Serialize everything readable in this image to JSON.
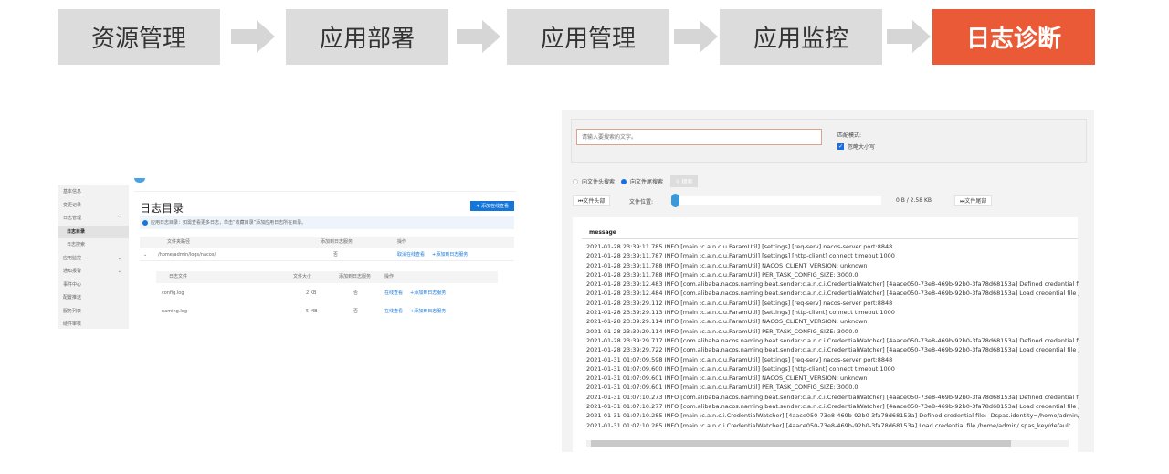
{
  "steps": [
    "资源管理",
    "应用部署",
    "应用管理",
    "应用监控",
    "日志诊断"
  ],
  "left_panel": {
    "sidebar": [
      "基本信息",
      "变更记录",
      "日志管理",
      "日志目录",
      "日志搜索",
      "应用监控",
      "通知报警",
      "事件中心",
      "配置推送",
      "服务列表",
      "硬件审核"
    ],
    "title": "日志目录",
    "add_button": "+ 添加在线查看",
    "info": "应用日志目录：如需查看更多日志，单击“收藏目录”添加应用日志所在目录。",
    "headers": [
      "文件夹路径",
      "添加到日志服务",
      "操作"
    ],
    "folder": {
      "path": "/home/admin/logs/nacos/",
      "added": "否",
      "action1": "取消在线查看",
      "action2": "+添加到日志服务"
    },
    "sub_headers": [
      "日志文件",
      "文件大小",
      "添加到日志服务",
      "操作"
    ],
    "files": [
      {
        "name": "config.log",
        "size": "2 KB",
        "added": "否",
        "action1": "在线查看",
        "action2": "+添加到日志服务"
      },
      {
        "name": "naming.log",
        "size": "5 MB",
        "added": "否",
        "action1": "在线查看",
        "action2": "+添加到日志服务"
      }
    ]
  },
  "right_panel": {
    "search_placeholder": "请输入要搜索的文字。",
    "match_mode_label": "匹配模式:",
    "ignore_case_label": "忽略大小写",
    "ignore_case_checked": true,
    "radio_head": "向文件头搜索",
    "radio_tail": "向文件尾搜索",
    "search_button": "搜索",
    "file_head_button": "文件头部",
    "file_position_label": "文件位置:",
    "position_text": "0 B / 2.58 KB",
    "position_fraction": 0,
    "file_tail_button": "文件尾部",
    "column": "message",
    "lines": [
      "2021-01-28 23:39:11.785 INFO [main :c.a.n.c.u.ParamUtil] [settings] [req-serv] nacos-server port:8848",
      "2021-01-28 23:39:11.787 INFO [main :c.a.n.c.u.ParamUtil] [settings] [http-client] connect timeout:1000",
      "2021-01-28 23:39:11.788 INFO [main :c.a.n.c.u.ParamUtil] NACOS_CLIENT_VERSION: unknown",
      "2021-01-28 23:39:11.788 INFO [main :c.a.n.c.u.ParamUtil] PER_TASK_CONFIG_SIZE: 3000.0",
      "2021-01-28 23:39:12.483 INFO [com.alibaba.nacos.naming.beat.sender:c.a.n.c.i.CredentialWatcher] [4aace050-73e8-469b-92b0-3fa78d68153a] Defined credential file: -Dspas.identity=/home",
      "2021-01-28 23:39:12.484 INFO [com.alibaba.nacos.naming.beat.sender:c.a.n.c.i.CredentialWatcher] [4aace050-73e8-469b-92b0-3fa78d68153a] Load credential file /home/admin/.spas_key/",
      "2021-01-28 23:39:29.112 INFO [main :c.a.n.c.u.ParamUtil] [settings] [req-serv] nacos-server port:8848",
      "2021-01-28 23:39:29.113 INFO [main :c.a.n.c.u.ParamUtil] [settings] [http-client] connect timeout:1000",
      "2021-01-28 23:39:29.114 INFO [main :c.a.n.c.u.ParamUtil] NACOS_CLIENT_VERSION: unknown",
      "2021-01-28 23:39:29.114 INFO [main :c.a.n.c.u.ParamUtil] PER_TASK_CONFIG_SIZE: 3000.0",
      "2021-01-28 23:39:29.717 INFO [com.alibaba.nacos.naming.beat.sender:c.a.n.c.i.CredentialWatcher] [4aace050-73e8-469b-92b0-3fa78d68153a] Defined credential file: -Dspas.identity=/home",
      "2021-01-28 23:39:29.722 INFO [com.alibaba.nacos.naming.beat.sender:c.a.n.c.i.CredentialWatcher] [4aace050-73e8-469b-92b0-3fa78d68153a] Load credential file /home/admin/.spas_key/",
      "2021-01-31 01:07:09.598 INFO [main :c.a.n.c.u.ParamUtil] [settings] [req-serv] nacos-server port:8848",
      "2021-01-31 01:07:09.600 INFO [main :c.a.n.c.u.ParamUtil] [settings] [http-client] connect timeout:1000",
      "2021-01-31 01:07:09.601 INFO [main :c.a.n.c.u.ParamUtil] NACOS_CLIENT_VERSION: unknown",
      "2021-01-31 01:07:09.601 INFO [main :c.a.n.c.u.ParamUtil] PER_TASK_CONFIG_SIZE: 3000.0",
      "2021-01-31 01:07:10.273 INFO [com.alibaba.nacos.naming.beat.sender:c.a.n.c.i.CredentialWatcher] [4aace050-73e8-469b-92b0-3fa78d68153a] Defined credential file: -Dspas.identity=/home",
      "2021-01-31 01:07:10.277 INFO [com.alibaba.nacos.naming.beat.sender:c.a.n.c.i.CredentialWatcher] [4aace050-73e8-469b-92b0-3fa78d68153a] Load credential file /home/admin/.spas_key/",
      "2021-01-31 01:07:10.285 INFO [main :c.a.n.c.i.CredentialWatcher] [4aace050-73e8-469b-92b0-3fa78d68153a] Defined credential file: -Dspas.identity=/home/admin/.spas_key/default",
      "2021-01-31 01:07:10.285 INFO [main :c.a.n.c.i.CredentialWatcher] [4aace050-73e8-469b-92b0-3fa78d68153a] Load credential file /home/admin/.spas_key/default"
    ]
  }
}
